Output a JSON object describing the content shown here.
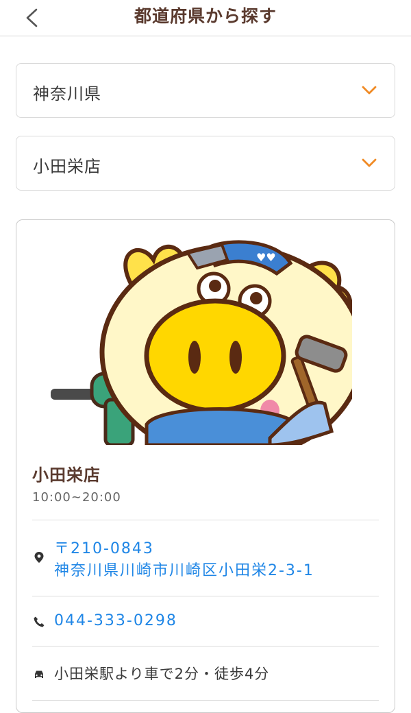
{
  "header": {
    "title": "都道府県から探す",
    "back_icon": "chevron-left-icon"
  },
  "filters": {
    "prefecture": {
      "value": "神奈川県",
      "icon": "chevron-down-icon"
    },
    "store": {
      "value": "小田栄店",
      "icon": "chevron-down-icon"
    }
  },
  "store": {
    "name": "小田栄店",
    "hours": "10:00~20:00",
    "postal": "〒210-0843",
    "address": "神奈川県川崎市川崎区小田栄2-3-1",
    "phone": "044-333-0298",
    "access": "小田栄駅より車で2分・徒歩4分",
    "icons": {
      "address": "location-pin-icon",
      "phone": "phone-icon",
      "access": "car-icon"
    }
  },
  "colors": {
    "accent": "#f08a24",
    "title": "#5a3a2e",
    "link": "#1f86e6"
  }
}
